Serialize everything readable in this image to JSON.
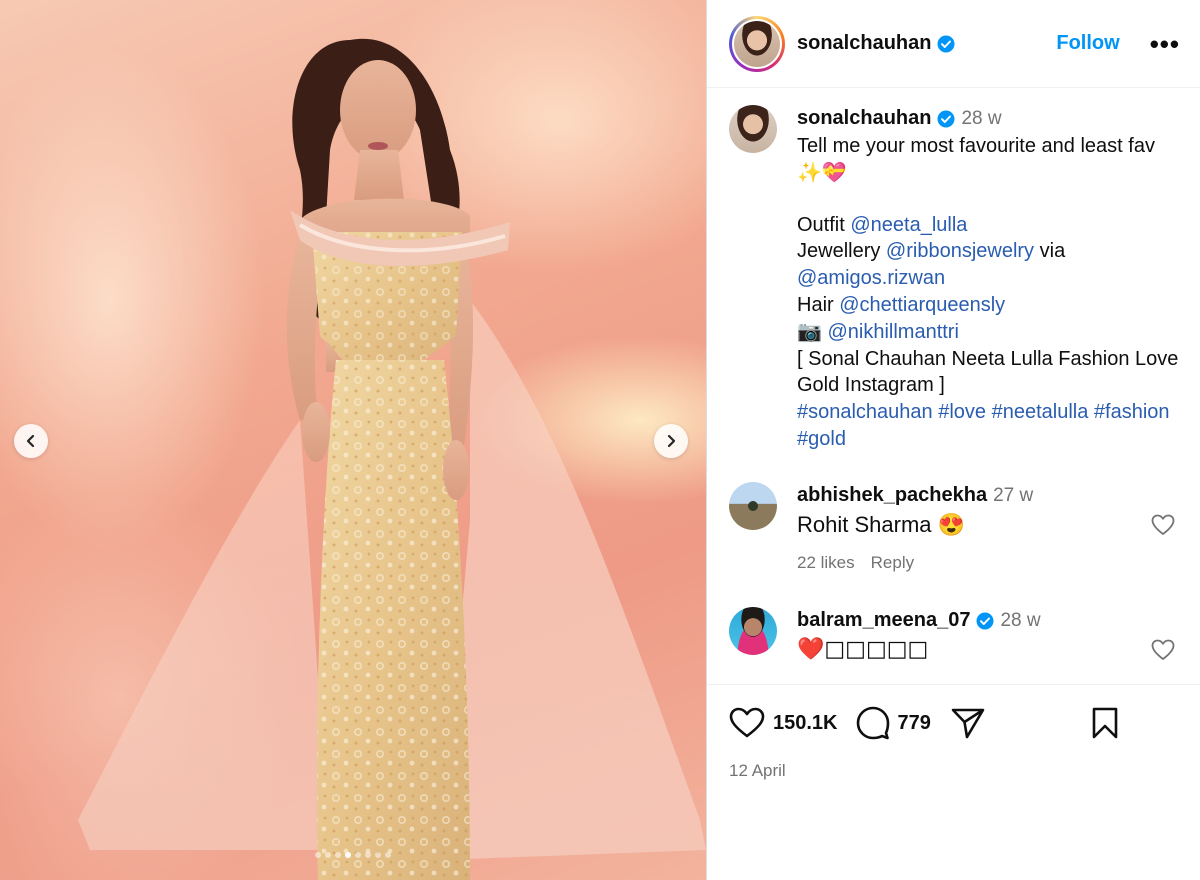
{
  "post": {
    "username": "sonalchauhan",
    "follow_label": "Follow",
    "more_label": "•••",
    "carousel": {
      "slide_count": 8,
      "active_index": 3
    }
  },
  "caption": {
    "username": "sonalchauhan",
    "time": "28 w",
    "line1": "Tell me your most favourite and least fav",
    "line2": "✨💝",
    "outfit_label": "Outfit",
    "outfit_handle": "@neeta_lulla",
    "jewellery_label": "Jewellery",
    "jewellery_handle": "@ribbonsjewelry",
    "via_label": "via",
    "via_handle": "@amigos.rizwan",
    "hair_label": "Hair",
    "hair_handle": "@chettiarqueensly",
    "camera_emoji": "📷",
    "photo_handle": "@nikhillmanttri",
    "bracket_line1": "[ Sonal Chauhan Neeta Lulla Fashion Love",
    "bracket_line2": "Gold Instagram ]",
    "hashtags_line1": "#sonalchauhan #love #neetalulla #fashion",
    "hashtags_line2": "#gold"
  },
  "comments": [
    {
      "username": "abhishek_pachekha",
      "time": "27 w",
      "text": "Rohit Sharma 😍",
      "likes": "22 likes",
      "reply_label": "Reply"
    },
    {
      "username": "balram_meena_07",
      "time": "28 w",
      "text": "❤️□□□□□"
    }
  ],
  "actions": {
    "likes_count": "150.1K",
    "comments_count": "779",
    "date": "12 April"
  },
  "colors": {
    "link": "#2a5db0",
    "follow": "#0095f6",
    "verified": "#0095f6",
    "muted": "#737373"
  }
}
